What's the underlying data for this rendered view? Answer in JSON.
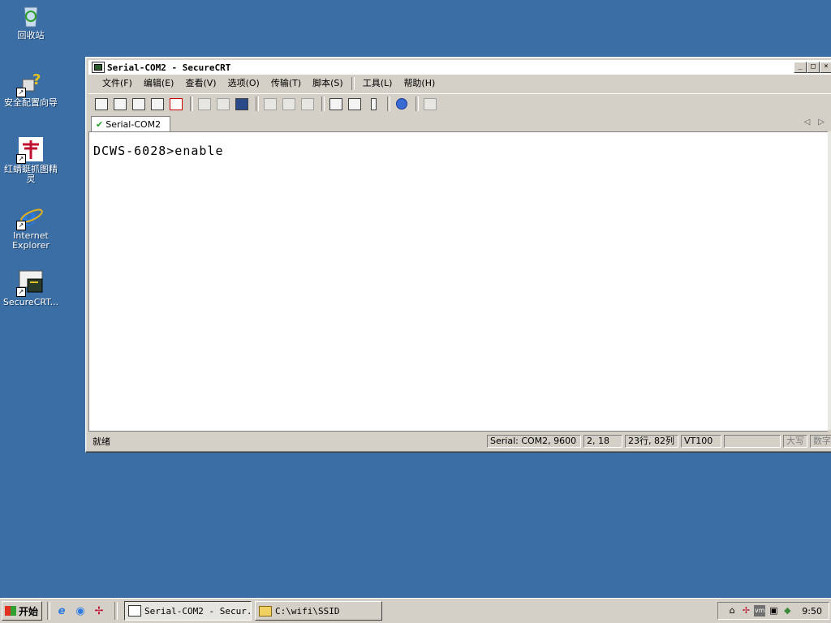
{
  "desktop": {
    "icons": [
      {
        "label": "回收站",
        "icon": "recycle-bin-icon"
      },
      {
        "label": "安全配置向导",
        "icon": "security-wizard-icon"
      },
      {
        "label": "红蜻蜓抓图精灵",
        "icon": "dragonfly-capture-icon"
      },
      {
        "label": "Internet Explorer",
        "icon": "internet-explorer-icon"
      },
      {
        "label": "SecureCRT...",
        "icon": "securecrt-icon"
      }
    ]
  },
  "window": {
    "title": "Serial-COM2 - SecureCRT",
    "buttons": {
      "minimize": "_",
      "maximize": "□",
      "close": "×"
    }
  },
  "menu": {
    "items": [
      "文件(F)",
      "编辑(E)",
      "查看(V)",
      "选项(O)",
      "传输(T)",
      "脚本(S)",
      "工具(L)",
      "帮助(H)"
    ]
  },
  "tab": {
    "label": "Serial-COM2"
  },
  "terminal": {
    "text": "DCWS-6028>enable"
  },
  "status": {
    "text": "就绪",
    "connection": "Serial: COM2, 9600",
    "cursor": "2,  18",
    "size": "23行, 82列",
    "emulation": "VT100",
    "blank": "",
    "caps": "大写",
    "num": "数字"
  },
  "taskbar": {
    "start": "开始",
    "tasks": [
      {
        "label": "Serial-COM2 - Secur...",
        "active": true
      },
      {
        "label": "C:\\wifi\\SSID",
        "active": false
      }
    ],
    "clock": "9:50"
  }
}
